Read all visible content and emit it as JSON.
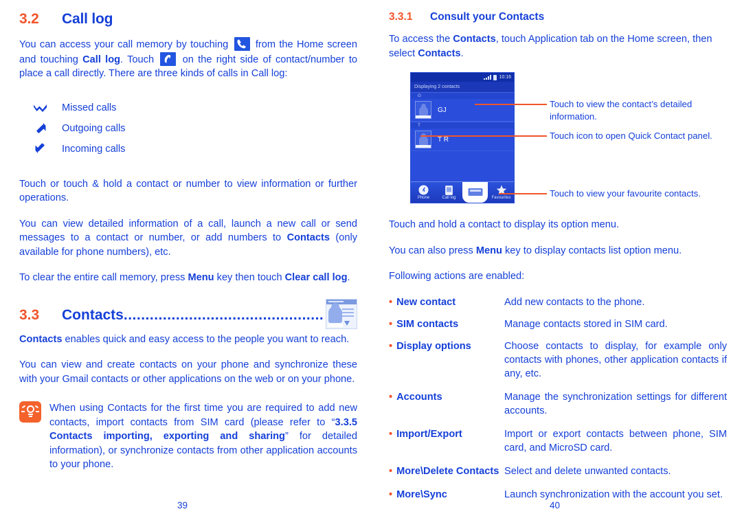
{
  "colors": {
    "heading_number": "#f0552a",
    "body_text": "#1540d8",
    "tip_icon_bg": "#f4622c",
    "phone_bg": "#1d3fc6",
    "callout_line": "#f0552a"
  },
  "left_column": {
    "section": {
      "number": "3.2",
      "title": "Call log"
    },
    "intro_parts": {
      "p1a": "You can access your call memory by touching ",
      "p1b": " from the Home screen and touching ",
      "p1c": "Call log",
      "p1d": ". Touch ",
      "p1e": " on the right side of contact/number to place a call directly. There are three kinds of calls in Call log:"
    },
    "call_types": [
      {
        "icon": "missed-call-icon",
        "label": "Missed calls"
      },
      {
        "icon": "outgoing-call-icon",
        "label": "Outgoing calls"
      },
      {
        "icon": "incoming-call-icon",
        "label": "Incoming calls"
      }
    ],
    "p2": "Touch or touch & hold a contact or number to view information or further operations.",
    "p3": {
      "a": "You can view detailed information of a call, launch a new call or send messages to a contact or number, or add numbers to ",
      "b": "Contacts",
      "c": " (only available for phone numbers), etc."
    },
    "p4": {
      "a": "To clear the entire call memory, press ",
      "b": "Menu",
      "c": " key then touch ",
      "d": "Clear call log",
      "e": "."
    },
    "contacts_section": {
      "number": "3.3",
      "title": "Contacts",
      "leader_dots": "........................................................................................."
    },
    "p5": {
      "a": "Contacts",
      "b": " enables quick and easy access to the people you want to reach."
    },
    "p6": "You can view and create contacts on your phone and synchronize these with your Gmail contacts or other applications on the web or on your phone.",
    "tip": {
      "a": "When using Contacts for the first time you are required to add new contacts, import contacts from SIM card (please refer to “",
      "b": "3.3.5 Contacts importing, exporting and sharing",
      "c": "” for detailed information), or synchronize contacts from other application accounts to your phone."
    },
    "page_number": "39"
  },
  "right_column": {
    "section": {
      "number": "3.3.1",
      "title": "Consult your Contacts"
    },
    "p1": {
      "a": "To access the ",
      "b": "Contacts",
      "c": ", touch Application tab on the Home screen, then select ",
      "d": "Contacts",
      "e": "."
    },
    "phone_mock": {
      "status": {
        "time": "10:16",
        "signal_icon": "signal-bars-icon",
        "battery_icon": "battery-icon"
      },
      "title_bar": "Displaying 2 contacts",
      "groups": [
        {
          "letter": "G",
          "contacts": [
            {
              "name": "GJ"
            }
          ]
        },
        {
          "letter": "T",
          "contacts": [
            {
              "name": "T R"
            }
          ]
        }
      ],
      "tabs": [
        {
          "label": "Phone",
          "icon": "phone-icon"
        },
        {
          "label": "Call log",
          "icon": "call-log-icon"
        },
        {
          "label": "",
          "icon": "contacts-icon"
        },
        {
          "label": "Favourites",
          "icon": "star-icon"
        }
      ]
    },
    "callouts": [
      "Touch to view the contact’s detailed information.",
      "Touch icon to open Quick Contact panel.",
      "Touch to view your favourite contacts."
    ],
    "p2": "Touch and hold a contact to display its option menu.",
    "p3": {
      "a": "You can also press ",
      "b": "Menu",
      "c": " key to display contacts list option menu."
    },
    "p4": "Following actions are enabled:",
    "actions": [
      {
        "bullet": "•",
        "term": "New contact",
        "desc": "Add new contacts to the phone.",
        "justify": false
      },
      {
        "bullet": "•",
        "term": "SIM contacts",
        "desc": "Manage contacts stored in SIM card.",
        "justify": false
      },
      {
        "bullet": "•",
        "term": "Display options",
        "desc": "Choose contacts to display, for example only contacts with phones, other application contacts if any, etc.",
        "justify": true
      },
      {
        "bullet": "•",
        "term": "Accounts",
        "desc": "Manage the synchronization settings for different accounts.",
        "justify": true
      },
      {
        "bullet": "•",
        "term": "Import/Export",
        "desc": "Import or export contacts between phone, SIM card, and MicroSD card.",
        "justify": true
      },
      {
        "bullet": "•",
        "term": "More\\Delete Contacts",
        "desc": "Select and delete unwanted contacts.",
        "justify": false
      },
      {
        "bullet": "•",
        "term": "More\\Sync",
        "desc": "Launch synchronization with the account you set.",
        "justify": true
      }
    ],
    "page_number": "40"
  }
}
